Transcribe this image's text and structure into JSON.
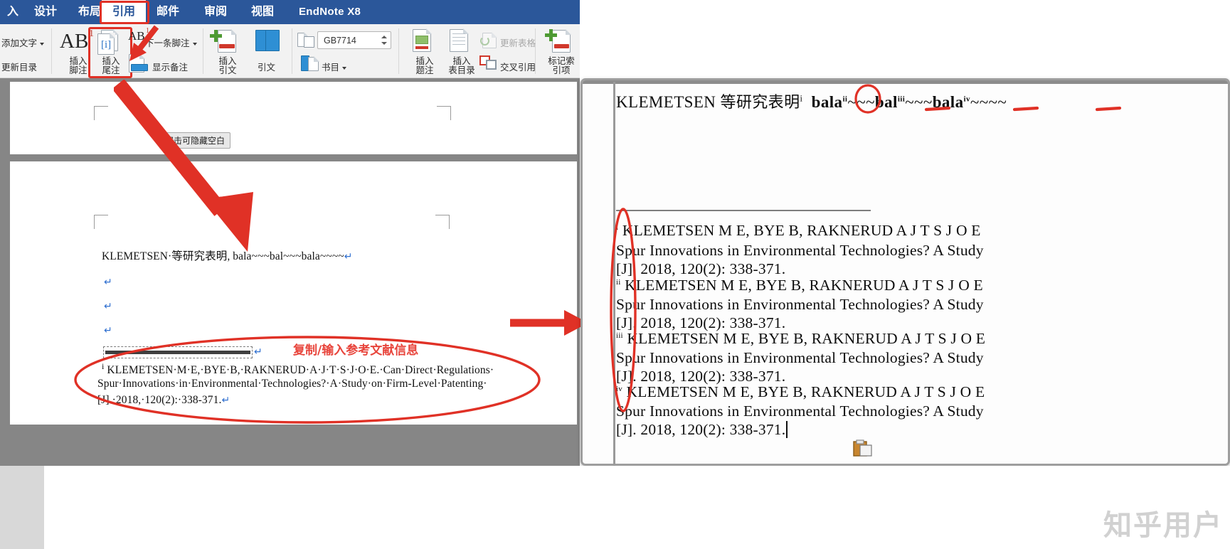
{
  "app": {
    "name": "Microsoft Word",
    "accent_blue": "#2b579a",
    "annotation_red": "#e03126"
  },
  "ribbon": {
    "tabs": [
      {
        "label": "入",
        "active": false
      },
      {
        "label": "设计",
        "active": false
      },
      {
        "label": "布局",
        "active": false
      },
      {
        "label": "引用",
        "active": true
      },
      {
        "label": "邮件",
        "active": false
      },
      {
        "label": "审阅",
        "active": false
      },
      {
        "label": "视图",
        "active": false
      },
      {
        "label": "EndNote X8",
        "active": false
      }
    ],
    "groups": {
      "toc": {
        "add_text": "添加文字",
        "update_toc": "更新目录"
      },
      "footnotes": {
        "insert_footnote": "插入\n脚注",
        "insert_footnote_l1": "插入",
        "insert_footnote_l2": "脚注",
        "insert_endnote_l1": "插入",
        "insert_endnote_l2": "尾注",
        "next_footnote": "下一条脚注",
        "show_notes": "显示备注"
      },
      "citations": {
        "insert_citation_l1": "插入",
        "insert_citation_l2": "引文",
        "bibliography_manage": "引文",
        "style_value": "GB7714",
        "bibliography": "书目"
      },
      "captions": {
        "insert_caption_l1": "插入",
        "insert_caption_l2": "题注",
        "insert_table_of_figures_l1": "插入",
        "insert_table_of_figures_l2": "表目录",
        "update_table": "更新表格",
        "cross_reference": "交叉引用"
      },
      "index": {
        "mark_entry_l1": "标记索",
        "mark_entry_l2": "引项"
      }
    }
  },
  "left_document": {
    "hide_whitespace_tip": "双击可隐藏空白",
    "body_text": "KLEMETSEN· 等研究表明|,  bala~~~bal~~~bala~~~~",
    "body_prefix": "KLEMETSEN·",
    "body_cn": "等研究表明",
    "body_suffix": ",  bala~~~bal~~~bala~~~~",
    "pilcrow": "↵",
    "annotation": "复制/输入参考文献信息",
    "reference_lines": [
      "KLEMETSEN·M·E,·BYE·B,·RAKNERUD·A·J·T·S·J·O·E.·Can·Direct·Regulations·",
      "Spur·Innovations·in·Environmental·Technologies?·A·Study·on·Firm-Level·Patenting·",
      "[J].·2018,·120(2):·338-371."
    ]
  },
  "right_panel": {
    "heading": {
      "prefix": "KLEMETSEN",
      "cn": "等研究表明",
      "marker_1": "i",
      "bala_1": "bala",
      "marker_2": "ii",
      "tilde_1": "~~~",
      "bala_2": "bal",
      "marker_3": "iii",
      "tilde_2": "~~~",
      "bala_3": "bala",
      "marker_4": "iv",
      "tilde_3": "~~~~"
    },
    "endnotes": [
      {
        "marker": "i",
        "lines": [
          "KLEMETSEN M E, BYE B, RAKNERUD A J T S J O E",
          "Spur Innovations in Environmental Technologies? A Study",
          "[J]. 2018, 120(2): 338-371."
        ]
      },
      {
        "marker": "ii",
        "lines": [
          "KLEMETSEN M E, BYE B, RAKNERUD A J T S J O E",
          "Spur Innovations in Environmental Technologies? A Study",
          "[J]. 2018, 120(2): 338-371."
        ]
      },
      {
        "marker": "iii",
        "lines": [
          "KLEMETSEN M E, BYE B, RAKNERUD A J T S J O E",
          "Spur Innovations in Environmental Technologies? A Study",
          "[J]. 2018, 120(2): 338-371."
        ]
      },
      {
        "marker": "iv",
        "lines": [
          "KLEMETSEN M E, BYE B, RAKNERUD A J T S J O E",
          "Spur Innovations in Environmental Technologies? A Study",
          "[J]. 2018, 120(2): 338-371."
        ]
      }
    ]
  },
  "watermark": "知乎用户"
}
